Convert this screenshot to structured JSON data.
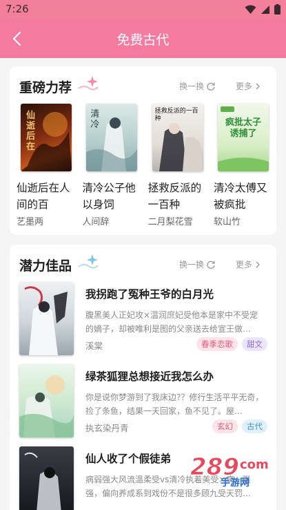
{
  "status_bar": {
    "time": "7:26",
    "icons": [
      "wifi-icon",
      "signal-icon",
      "battery-icon"
    ]
  },
  "header": {
    "title": "免费古代",
    "back_icon": "back-arrow-icon"
  },
  "featured": {
    "title": "重磅力荐",
    "refresh_label": "换一换",
    "more_label": "更多",
    "books": [
      {
        "title": "仙逝后在人间的百",
        "author": "艺墨两",
        "cover_text": "仙逝后在"
      },
      {
        "title": "清冷公子他以身饲",
        "author": "人间辞",
        "cover_text": "清冷"
      },
      {
        "title": "拯救反派的一百种",
        "author": "二月梨花雪",
        "cover_text": "拯救反派的一百种"
      },
      {
        "title": "清冷太傅又被疯批",
        "author": "软山竹",
        "cover_text": "疯批太子诱捕了"
      }
    ]
  },
  "potential": {
    "title": "潜力佳品",
    "refresh_label": "换一换",
    "more_label": "更多",
    "books": [
      {
        "title": "我拐跑了冤种王爷的白月光",
        "desc": "腹黑美人正妃攻×温润庶妃受他本是家中不受宠的嫡子，却被唯利是图的父亲送去给宣王做…",
        "author": "溪棠",
        "tags": [
          {
            "label": "春季恋歌",
            "style": "pink"
          },
          {
            "label": "甜文",
            "style": "purple"
          }
        ]
      },
      {
        "title": "绿茶狐狸总想接近我怎么办",
        "desc": "你是说你梦游到了我床边?？修行生活平平无奇，捡了条鱼，结果一天回家，鱼不见了。屋…",
        "author": "执玄染丹青",
        "tags": [
          {
            "label": "玄幻",
            "style": "pink"
          },
          {
            "label": "古代",
            "style": "blue"
          }
        ]
      },
      {
        "title": "仙人收了个假徒弟",
        "desc": "病弱强大风流温柔受vs清冷执着美受×病，强强，偏向养成系到戏份不是很多顾九受天罚…",
        "author": "",
        "tags": []
      }
    ]
  },
  "watermark": {
    "number": "289",
    "suffix": "com",
    "text": "手游网"
  },
  "colors": {
    "header": "#f57aa0",
    "status_bar": "#f2809b",
    "accent_pink": "#e8577d"
  }
}
